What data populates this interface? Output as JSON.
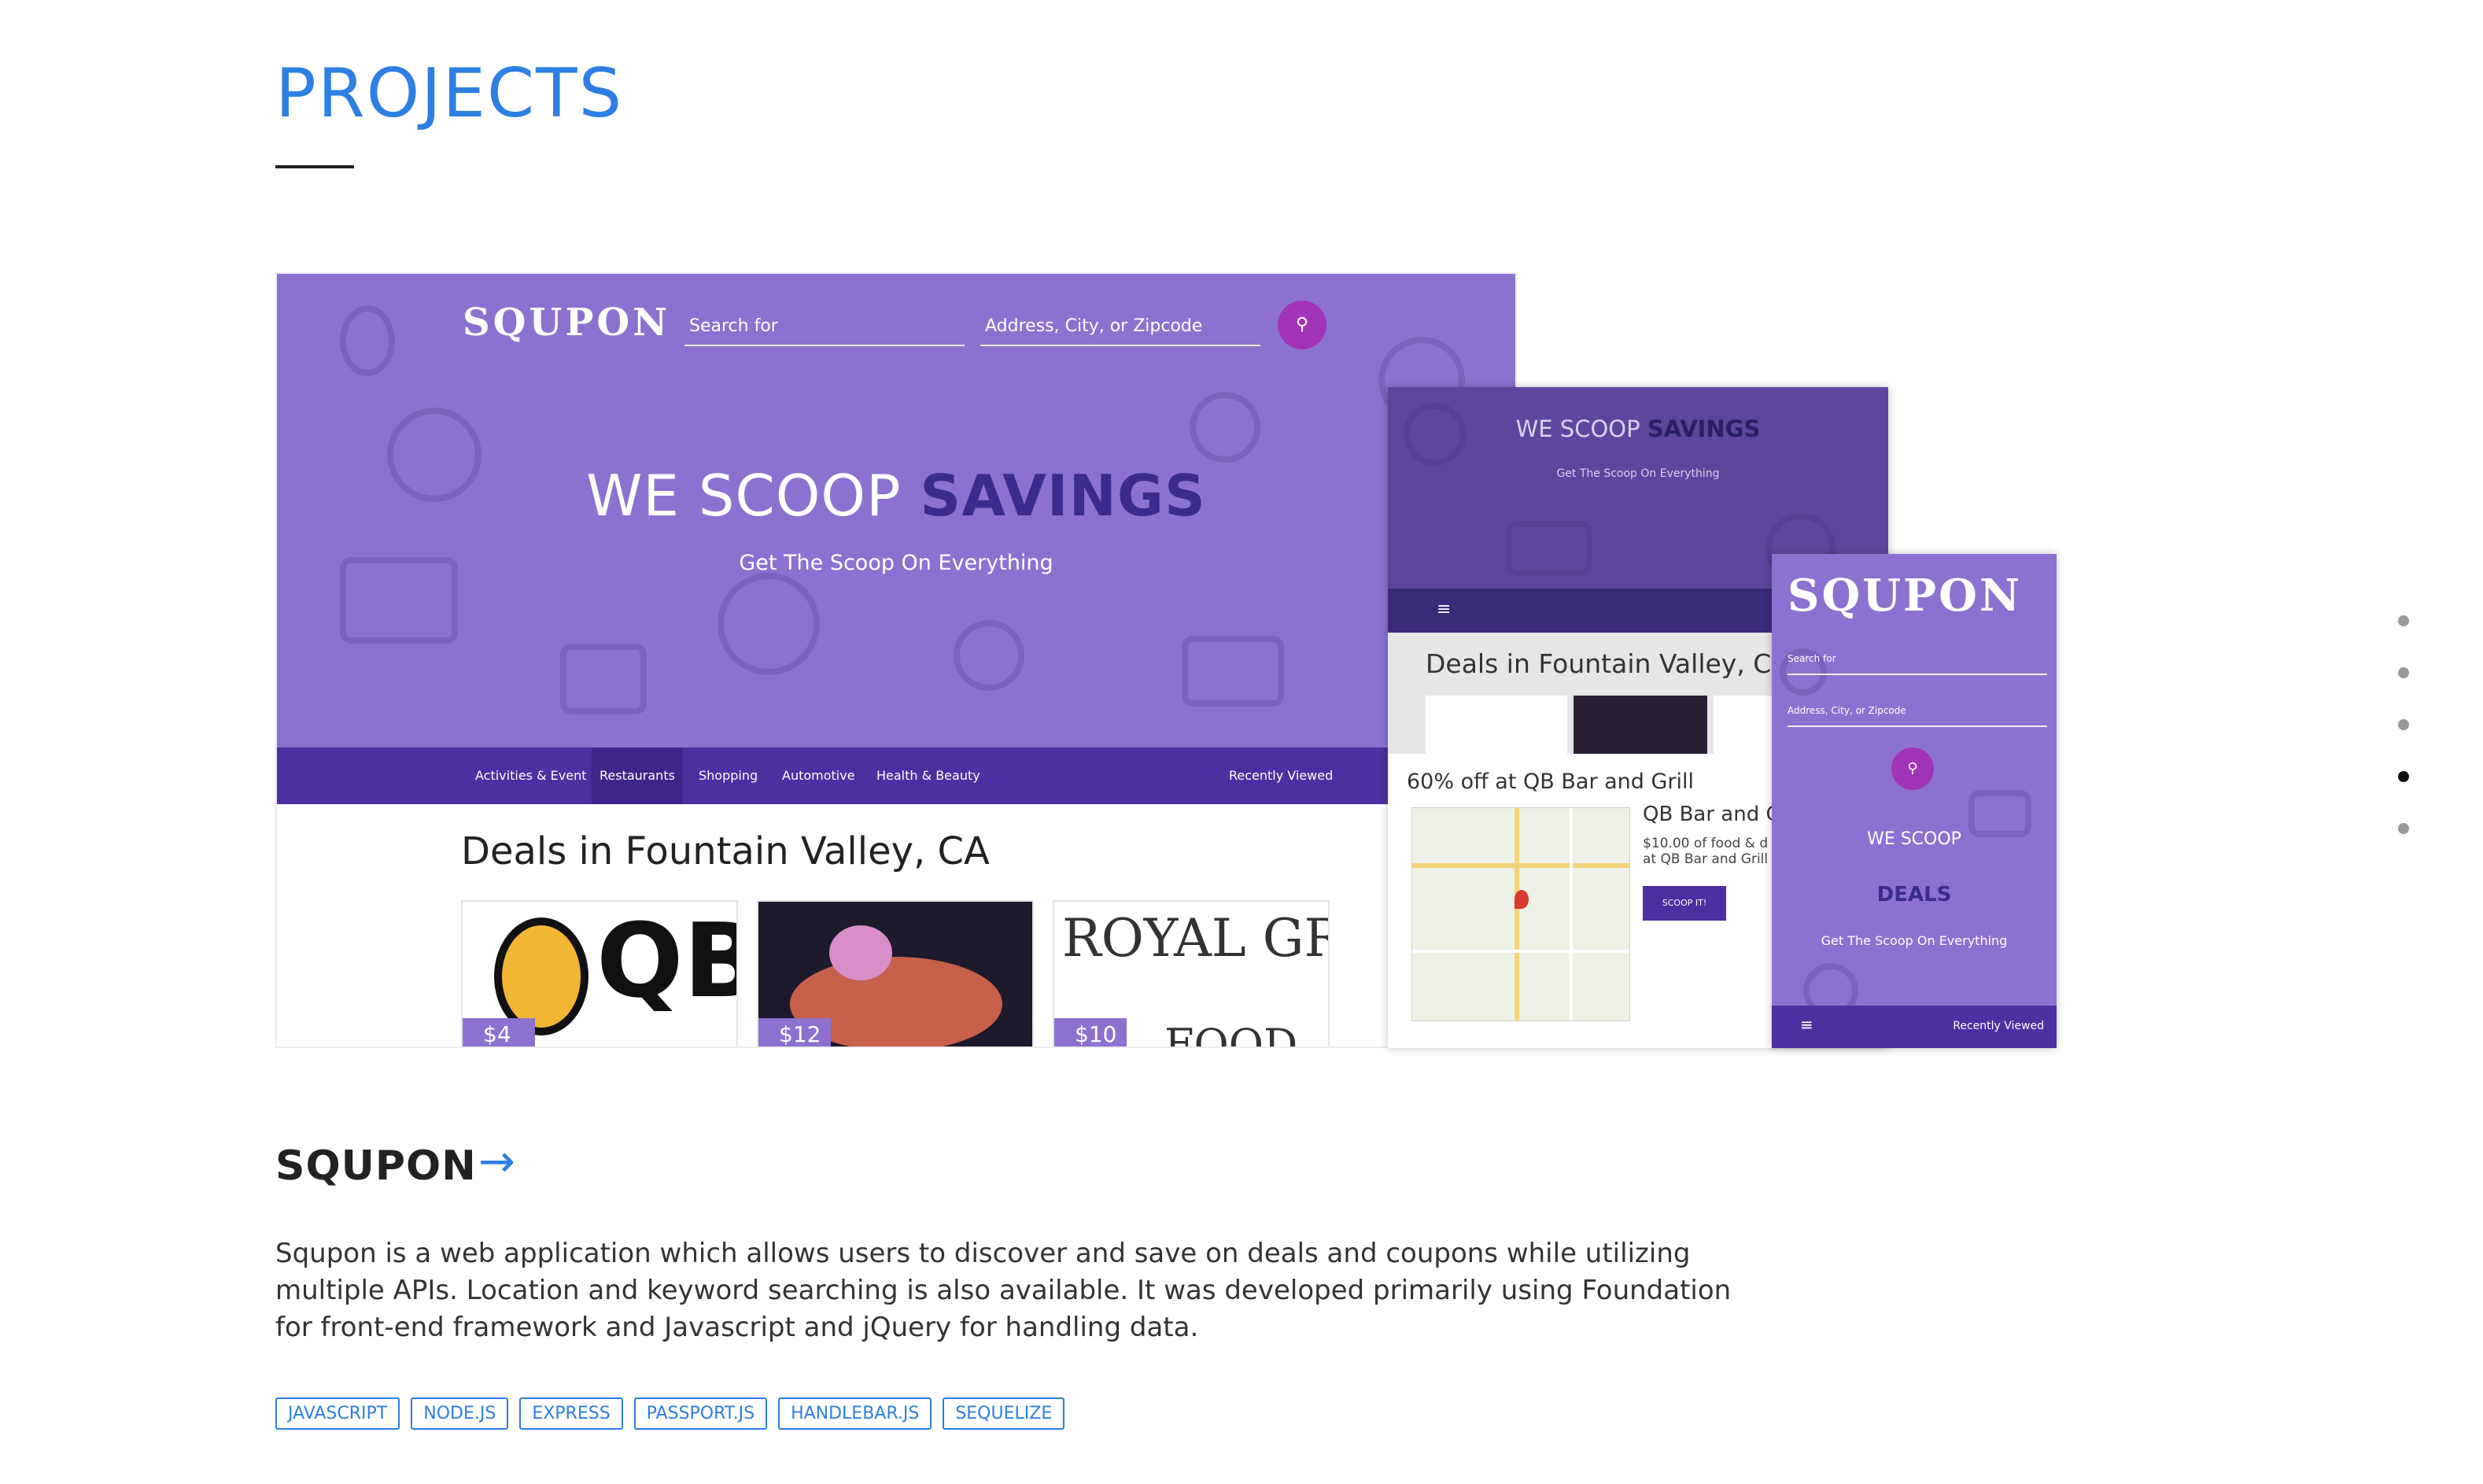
{
  "section": {
    "title": "PROJECTS"
  },
  "desktop": {
    "logo": "SQUPON",
    "search_placeholder": "Search for",
    "location_placeholder": "Address, City, or Zipcode",
    "tagline_light": "WE SCOOP ",
    "tagline_bold": "SAVINGS",
    "subtitle": "Get The Scoop On Everything",
    "nav": [
      "Activities & Event",
      "Restaurants",
      "Shopping",
      "Automotive",
      "Health & Beauty"
    ],
    "nav_active": "Restaurants",
    "recently_viewed": "Recently Viewed",
    "deals_title": "Deals in Fountain Valley, CA",
    "cards": [
      {
        "label": "QB",
        "price": "$4"
      },
      {
        "label": "",
        "price": "$12"
      },
      {
        "label": "ROYAL GRILL",
        "label2": "FOOD",
        "price": "$10"
      }
    ]
  },
  "tablet": {
    "tagline_light": "WE SCOOP ",
    "tagline_bold": "SAVINGS",
    "subtitle": "Get The Scoop On Everything",
    "menu_icon": "≡",
    "deals_title": "Deals in Fountain Valley, CA",
    "modal_title": "60% off at QB Bar and Grill",
    "business": "QB Bar and G",
    "business_desc": "$10.00 of food & d at QB Bar and Grill",
    "scoop_button": "SCOOP IT!"
  },
  "phone": {
    "logo": "SQUPON",
    "search_placeholder": "Search for",
    "location_placeholder": "Address, City, or Zipcode",
    "we_scoop": "WE SCOOP",
    "deals": "DEALS",
    "subtitle": "Get The Scoop On Everything",
    "menu_icon": "≡",
    "recently_viewed": "Recently Viewed"
  },
  "project": {
    "name": "SQUPON",
    "arrow": "→",
    "description": "Squpon is a web application which allows users to discover and save on deals and coupons while utilizing multiple APIs. Location and keyword searching is also available. It was developed primarily using Foundation for front-end framework and Javascript and jQuery for handling data.",
    "tags": [
      "JAVASCRIPT",
      "NODE.JS",
      "EXPRESS",
      "PASSPORT.JS",
      "HANDLEBAR.JS",
      "SEQUELIZE"
    ]
  },
  "side_nav": {
    "count": 5,
    "active_index": 3
  },
  "colors": {
    "accent": "#2e7fe3",
    "brand_purple": "#8b72d0",
    "nav_purple": "#4c2fa0"
  }
}
